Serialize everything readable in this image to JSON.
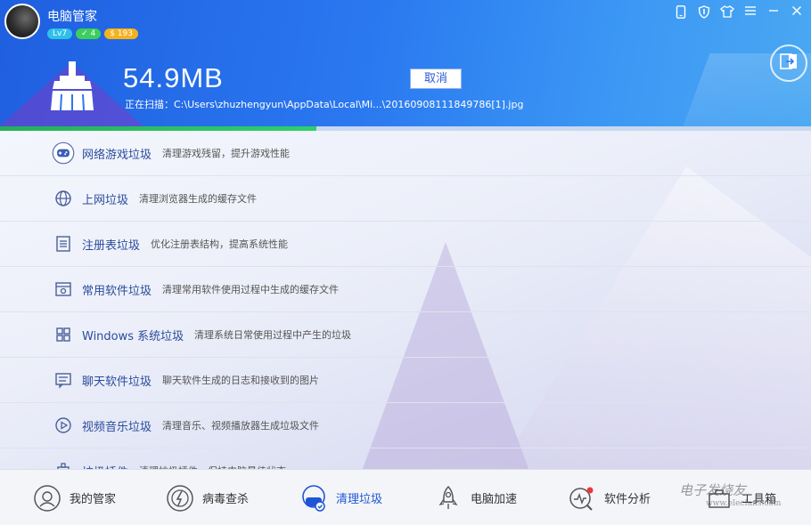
{
  "app": {
    "title": "电脑管家",
    "badges": {
      "level": "Lv7",
      "vip": "✓ 4",
      "coins": "$ 193"
    }
  },
  "window_controls": [
    {
      "icon": "phone-icon"
    },
    {
      "icon": "shield-icon"
    },
    {
      "icon": "shirt-icon"
    },
    {
      "icon": "menu-icon"
    },
    {
      "icon": "minimize-icon"
    },
    {
      "icon": "close-icon"
    }
  ],
  "scan": {
    "size": "54.9MB",
    "path": "正在扫描：C:\\Users\\zhuzhengyun\\AppData\\Local\\Mi...\\20160908111849786[1].jpg",
    "cancel_label": "取消",
    "progress": 0.39
  },
  "categories": [
    {
      "icon": "gamepad-icon",
      "name": "网络游戏垃圾",
      "desc": "清理游戏残留，提升游戏性能"
    },
    {
      "icon": "globe-icon",
      "name": "上网垃圾",
      "desc": "清理浏览器生成的缓存文件"
    },
    {
      "icon": "registry-icon",
      "name": "注册表垃圾",
      "desc": "优化注册表结构，提高系统性能"
    },
    {
      "icon": "app-box-icon",
      "name": "常用软件垃圾",
      "desc": "清理常用软件使用过程中生成的缓存文件"
    },
    {
      "icon": "windows-icon",
      "name": "Windows 系统垃圾",
      "desc": "清理系统日常使用过程中产生的垃圾"
    },
    {
      "icon": "chat-icon",
      "name": "聊天软件垃圾",
      "desc": "聊天软件生成的日志和接收到的图片"
    },
    {
      "icon": "play-icon",
      "name": "视频音乐垃圾",
      "desc": "清理音乐、视频播放器生成垃圾文件"
    },
    {
      "icon": "plugin-icon",
      "name": "垃圾插件",
      "desc": "清理垃圾插件，保持电脑最佳状态"
    }
  ],
  "nav": [
    {
      "icon": "butler-icon",
      "label": "我的管家"
    },
    {
      "icon": "virus-scan-icon",
      "label": "病毒查杀"
    },
    {
      "icon": "cleanup-icon",
      "label": "清理垃圾",
      "active": true
    },
    {
      "icon": "rocket-icon",
      "label": "电脑加速"
    },
    {
      "icon": "analysis-icon",
      "label": "软件分析"
    },
    {
      "icon": "toolbox-icon",
      "label": "工具箱"
    }
  ],
  "watermark": {
    "cn": "电子发烧友",
    "en": "www.elecfans.com"
  }
}
